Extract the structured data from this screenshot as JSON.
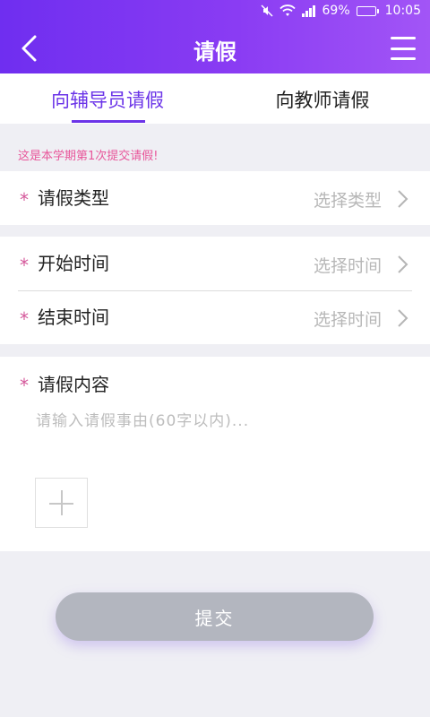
{
  "status_bar": {
    "battery": "69%",
    "time": "10:05",
    "battery_level": 0.69
  },
  "header": {
    "title": "请假"
  },
  "tabs": [
    {
      "label": "向辅导员请假",
      "active": true
    },
    {
      "label": "向教师请假",
      "active": false
    }
  ],
  "notice": "这是本学期第1次提交请假!",
  "required_mark": "*",
  "form": {
    "leave_type": {
      "label": "请假类型",
      "value": "选择类型"
    },
    "start_time": {
      "label": "开始时间",
      "value": "选择时间"
    },
    "end_time": {
      "label": "结束时间",
      "value": "选择时间"
    },
    "content": {
      "label": "请假内容",
      "placeholder": "请输入请假事由(60字以内)..."
    }
  },
  "submit_label": "提交",
  "colors": {
    "header_gradient_start": "#6f2ef0",
    "header_gradient_end": "#a255f6",
    "accent": "#6b34e8",
    "required": "#d4579a",
    "notice": "#e8569a",
    "submit_disabled": "#b3b6bf"
  },
  "icons": {
    "back": "chevron-left-icon",
    "menu": "hamburger-menu-icon",
    "chevron": "chevron-right-icon",
    "add": "plus-icon"
  }
}
